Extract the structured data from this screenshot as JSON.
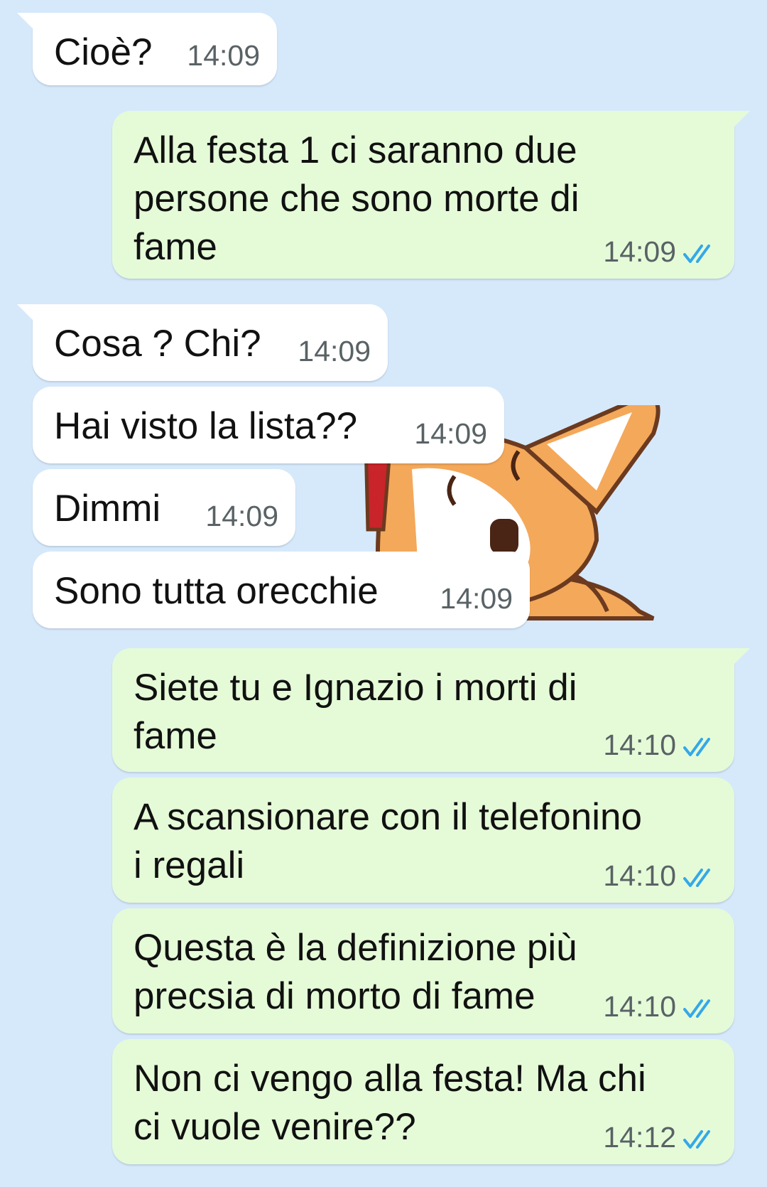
{
  "colors": {
    "background": "#d6e9fb",
    "incoming_bubble": "#ffffff",
    "outgoing_bubble": "#e5fbd8",
    "read_ticks": "#34a8e8"
  },
  "sticker": {
    "icon": "corgi-sticker"
  },
  "messages": [
    {
      "direction": "incoming",
      "text": "Cioè?",
      "time": "14:09"
    },
    {
      "direction": "outgoing",
      "text": "Alla festa 1 ci saranno due\npersone che sono morte di\nfame",
      "time": "14:09",
      "status": "read-double-check-icon"
    },
    {
      "direction": "incoming",
      "text": "Cosa ? Chi?",
      "time": "14:09"
    },
    {
      "direction": "incoming",
      "text": "Hai visto la lista??",
      "time": "14:09"
    },
    {
      "direction": "incoming",
      "text": "Dimmi",
      "time": "14:09"
    },
    {
      "direction": "incoming",
      "text": "Sono tutta orecchie",
      "time": "14:09"
    },
    {
      "direction": "outgoing",
      "text": "Siete tu e Ignazio i morti di\nfame",
      "time": "14:10",
      "status": "read-double-check-icon"
    },
    {
      "direction": "outgoing",
      "text": "A scansionare con il telefonino\ni regali",
      "time": "14:10",
      "status": "read-double-check-icon"
    },
    {
      "direction": "outgoing",
      "text": "Questa è la definizione più\nprecsia di morto di fame",
      "time": "14:10",
      "status": "read-double-check-icon"
    },
    {
      "direction": "outgoing",
      "text": "Non ci vengo alla festa! Ma chi\nci vuole venire??",
      "time": "14:12",
      "status": "read-double-check-icon"
    }
  ]
}
